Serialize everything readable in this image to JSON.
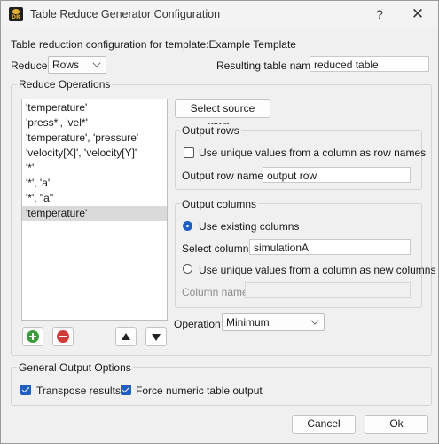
{
  "window": {
    "title": "Table Reduce Generator Configuration",
    "help_glyph": "?",
    "close_glyph": "✕"
  },
  "header": {
    "config_label": "Table reduction configuration for template:Example Template",
    "reduce_label": "Reduce",
    "reduce_value": "Rows",
    "result_name_label": "Resulting table name",
    "result_name_value": "reduced table"
  },
  "reduce_operations": {
    "title": "Reduce Operations",
    "items": [
      "'temperature'",
      "'press*', 'vel*'",
      "'temperature', 'pressure'",
      "'velocity[X]', 'velocity[Y]'",
      "'*'",
      "'*', 'a'",
      "'*', \"a\"",
      "'temperature'"
    ],
    "selected_index": 7,
    "select_source_button": "Select source rows...",
    "operation_label": "Operation",
    "operation_value": "Minimum"
  },
  "output_rows": {
    "title": "Output rows",
    "unique_values_label": "Use unique values from a column as row names",
    "unique_values_checked": false,
    "row_name_label": "Output row name",
    "row_name_value": "output row"
  },
  "output_columns": {
    "title": "Output columns",
    "use_existing_label": "Use existing columns",
    "use_existing_checked": true,
    "select_columns_label": "Select columns",
    "select_columns_value": "simulationA",
    "unique_values_label": "Use unique values from a column as new columns",
    "unique_values_checked": false,
    "column_name_label": "Column name",
    "column_name_value": ""
  },
  "general_output": {
    "title": "General Output Options",
    "transpose_label": "Transpose results",
    "transpose_checked": true,
    "force_numeric_label": "Force numeric table output",
    "force_numeric_checked": true
  },
  "footer": {
    "cancel_label": "Cancel",
    "ok_label": "Ok"
  },
  "icons": {
    "app": "app-logo-icon",
    "add": "add-icon",
    "remove": "remove-icon",
    "up": "arrow-up-icon",
    "down": "arrow-down-icon"
  },
  "colors": {
    "accent": "#1f5fbf",
    "add_green": "#3a9d3a",
    "remove_red": "#d23a3a",
    "selection": "#dadada"
  }
}
